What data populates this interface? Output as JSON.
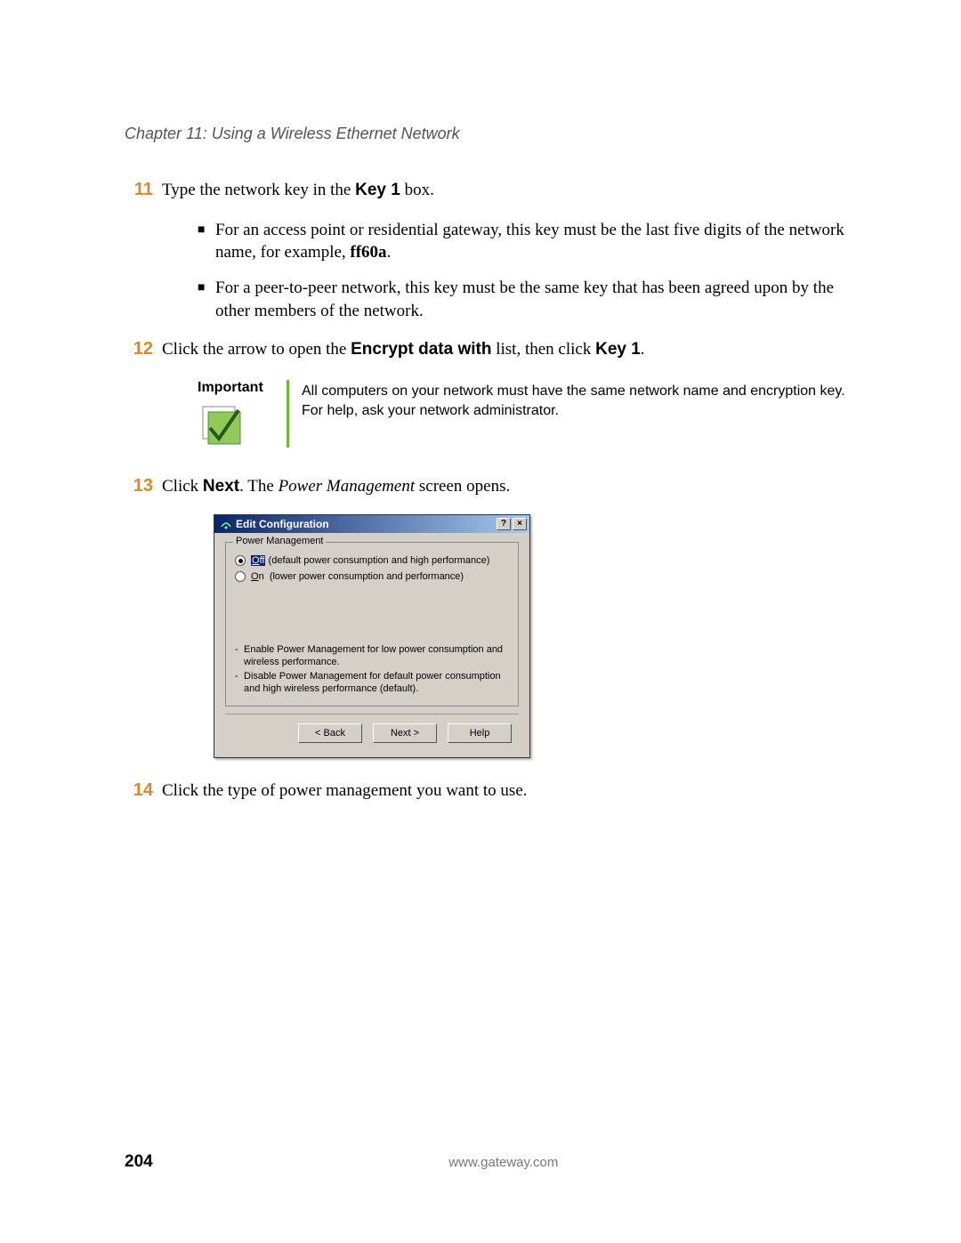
{
  "chapterHeader": "Chapter 11: Using a Wireless Ethernet Network",
  "steps": {
    "s11": {
      "num": "11",
      "prefix": "Type the network key in the ",
      "bold1": "Key 1",
      "suffix": " box."
    },
    "s11_bullets": [
      {
        "text_a": "For an access point or residential gateway, this key must be the last five digits of the network name, for example, ",
        "bold": "ff60a",
        "text_b": "."
      },
      {
        "text_a": "For a peer-to-peer network, this key must be the same key that has been agreed upon by the other members of the network.",
        "bold": "",
        "text_b": ""
      }
    ],
    "s12": {
      "num": "12",
      "p1": "Click the arrow to open the ",
      "b1": "Encrypt data with",
      "p2": " list, then click ",
      "b2": "Key 1",
      "p3": "."
    },
    "s13": {
      "num": "13",
      "p1": "Click ",
      "b1": "Next",
      "p2": ". The ",
      "i1": "Power Management",
      "p3": " screen opens."
    },
    "s14": {
      "num": "14",
      "text": "Click the type of power management you want to use."
    }
  },
  "important": {
    "label": "Important",
    "text": "All computers on your network must have the same network name and encryption key. For help, ask your network administrator."
  },
  "dialog": {
    "title": "Edit Configuration",
    "helpSymbol": "?",
    "closeSymbol": "×",
    "legend": "Power Management",
    "radio_off": {
      "label": "Off",
      "desc": "(default power consumption and high performance)"
    },
    "radio_on": {
      "label": "On",
      "desc": "(lower power consumption and performance)"
    },
    "hints": [
      "Enable Power Management for low power consumption and wireless performance.",
      "Disable Power Management for default power consumption and high wireless performance (default)."
    ],
    "buttons": {
      "back": "< Back",
      "next": "Next >",
      "help": "Help"
    }
  },
  "footer": {
    "pageNum": "204",
    "url": "www.gateway.com"
  }
}
